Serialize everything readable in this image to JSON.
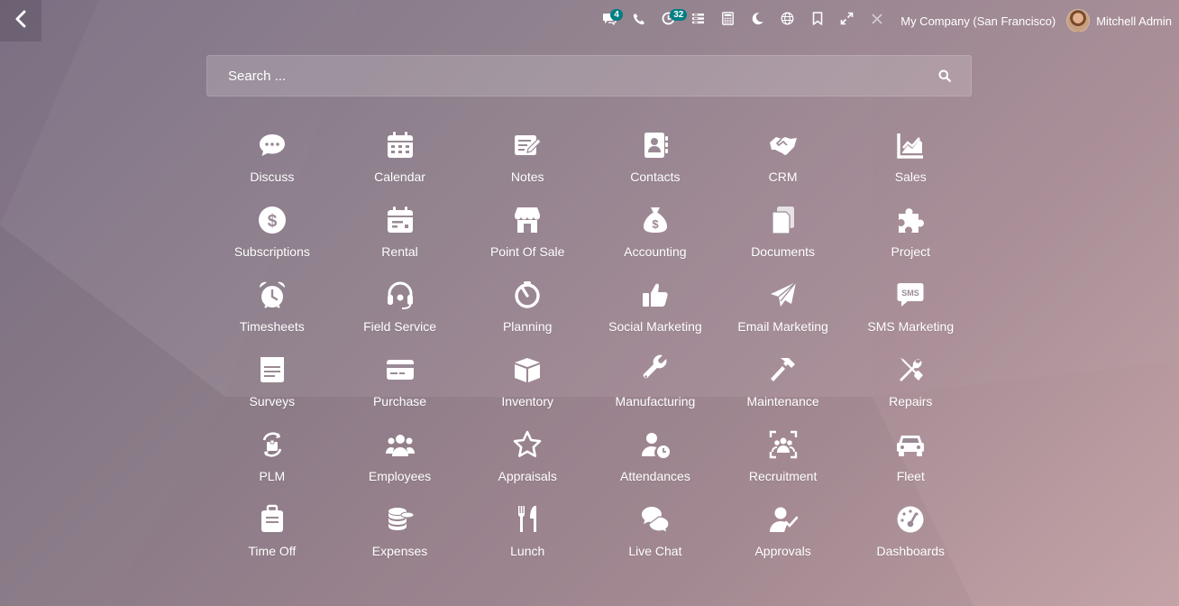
{
  "topbar": {
    "back_icon": "chevron-left-icon",
    "systray": [
      {
        "name": "messages-icon",
        "badge": "4"
      },
      {
        "name": "phone-icon",
        "badge": ""
      },
      {
        "name": "activities-icon",
        "badge": "32"
      },
      {
        "name": "list-icon",
        "badge": ""
      },
      {
        "name": "calculator-icon",
        "badge": ""
      },
      {
        "name": "moon-icon",
        "badge": ""
      },
      {
        "name": "globe-icon",
        "badge": ""
      },
      {
        "name": "bookmark-icon",
        "badge": ""
      },
      {
        "name": "expand-icon",
        "badge": ""
      },
      {
        "name": "tools-icon",
        "badge": ""
      }
    ],
    "company": "My Company (San Francisco)",
    "user_name": "Mitchell Admin"
  },
  "search": {
    "placeholder": "Search ..."
  },
  "apps": [
    {
      "label": "Discuss",
      "icon": "discuss-icon"
    },
    {
      "label": "Calendar",
      "icon": "calendar-icon"
    },
    {
      "label": "Notes",
      "icon": "notes-icon"
    },
    {
      "label": "Contacts",
      "icon": "contacts-icon"
    },
    {
      "label": "CRM",
      "icon": "handshake-icon"
    },
    {
      "label": "Sales",
      "icon": "sales-chart-icon"
    },
    {
      "label": "Subscriptions",
      "icon": "dollar-circle-icon"
    },
    {
      "label": "Rental",
      "icon": "rental-calendar-icon"
    },
    {
      "label": "Point Of Sale",
      "icon": "shop-icon"
    },
    {
      "label": "Accounting",
      "icon": "money-bag-icon"
    },
    {
      "label": "Documents",
      "icon": "documents-icon"
    },
    {
      "label": "Project",
      "icon": "puzzle-icon"
    },
    {
      "label": "Timesheets",
      "icon": "alarm-clock-icon"
    },
    {
      "label": "Field Service",
      "icon": "headset-icon"
    },
    {
      "label": "Planning",
      "icon": "planning-icon"
    },
    {
      "label": "Social Marketing",
      "icon": "thumbs-up-icon"
    },
    {
      "label": "Email Marketing",
      "icon": "paper-plane-icon"
    },
    {
      "label": "SMS Marketing",
      "icon": "sms-icon"
    },
    {
      "label": "Surveys",
      "icon": "survey-icon"
    },
    {
      "label": "Purchase",
      "icon": "credit-card-icon"
    },
    {
      "label": "Inventory",
      "icon": "box-icon"
    },
    {
      "label": "Manufacturing",
      "icon": "wrench-icon"
    },
    {
      "label": "Maintenance",
      "icon": "hammer-icon"
    },
    {
      "label": "Repairs",
      "icon": "tools-icon"
    },
    {
      "label": "PLM",
      "icon": "plm-icon"
    },
    {
      "label": "Employees",
      "icon": "employees-icon"
    },
    {
      "label": "Appraisals",
      "icon": "star-icon"
    },
    {
      "label": "Attendances",
      "icon": "attendance-icon"
    },
    {
      "label": "Recruitment",
      "icon": "recruitment-icon"
    },
    {
      "label": "Fleet",
      "icon": "car-icon"
    },
    {
      "label": "Time Off",
      "icon": "suitcase-icon"
    },
    {
      "label": "Expenses",
      "icon": "coins-icon"
    },
    {
      "label": "Lunch",
      "icon": "cutlery-icon"
    },
    {
      "label": "Live Chat",
      "icon": "chat-bubbles-icon"
    },
    {
      "label": "Approvals",
      "icon": "approval-icon"
    },
    {
      "label": "Dashboards",
      "icon": "dashboard-gauge-icon"
    }
  ]
}
